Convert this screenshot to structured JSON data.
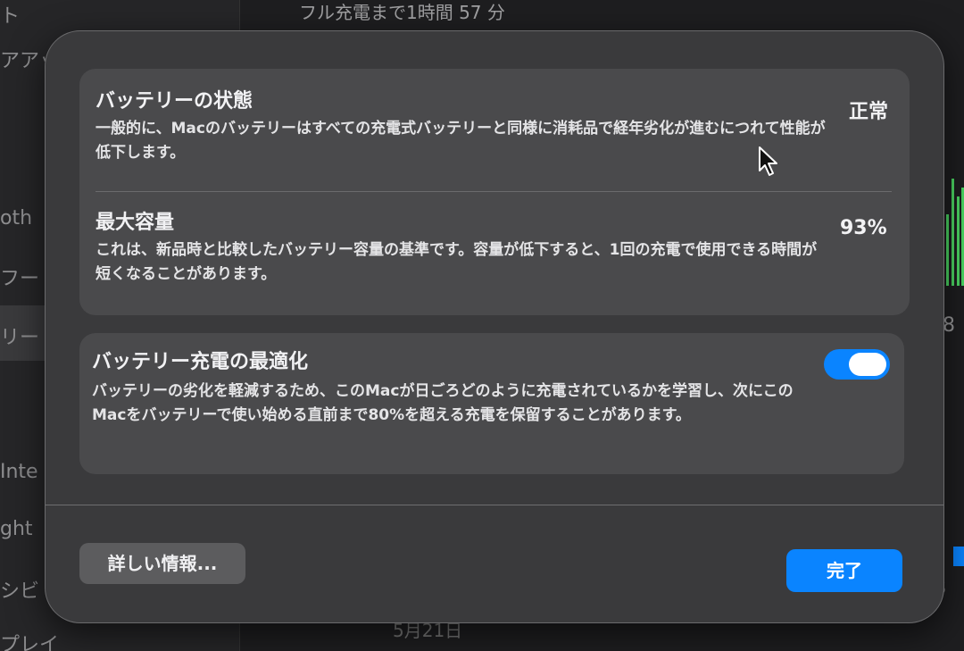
{
  "background": {
    "header_text": "フル充電まで1時間 57 分",
    "bottom_text": "5月21日",
    "sidebar_items": [
      "ト",
      "アアッ",
      "oth",
      "フー",
      "リー",
      "Inte",
      "ght",
      "シビ",
      "プレイ"
    ],
    "right_numbers": [
      "8",
      "8"
    ]
  },
  "battery_health": {
    "title": "バッテリーの状態",
    "description": "一般的に、Macのバッテリーはすべての充電式バッテリーと同様に消耗品で経年劣化が進むにつれて性能が低下します。",
    "value": "正常"
  },
  "max_capacity": {
    "title": "最大容量",
    "description": "これは、新品時と比較したバッテリー容量の基準です。容量が低下すると、1回の充電で使用できる時間が短くなることがあります。",
    "value": "93%"
  },
  "optimized_charging": {
    "title": "バッテリー充電の最適化",
    "description": "バッテリーの劣化を軽減するため、このMacが日ごろどのように充電されているかを学習し、次にこのMacをバッテリーで使い始める直前まで80%を超える充電を保留することがあります。",
    "enabled": true
  },
  "buttons": {
    "more_info": "詳しい情報...",
    "done": "完了"
  },
  "colors": {
    "accent": "#0a84ff",
    "sheet": "#3a3a3c",
    "card": "#4a4a4c"
  }
}
